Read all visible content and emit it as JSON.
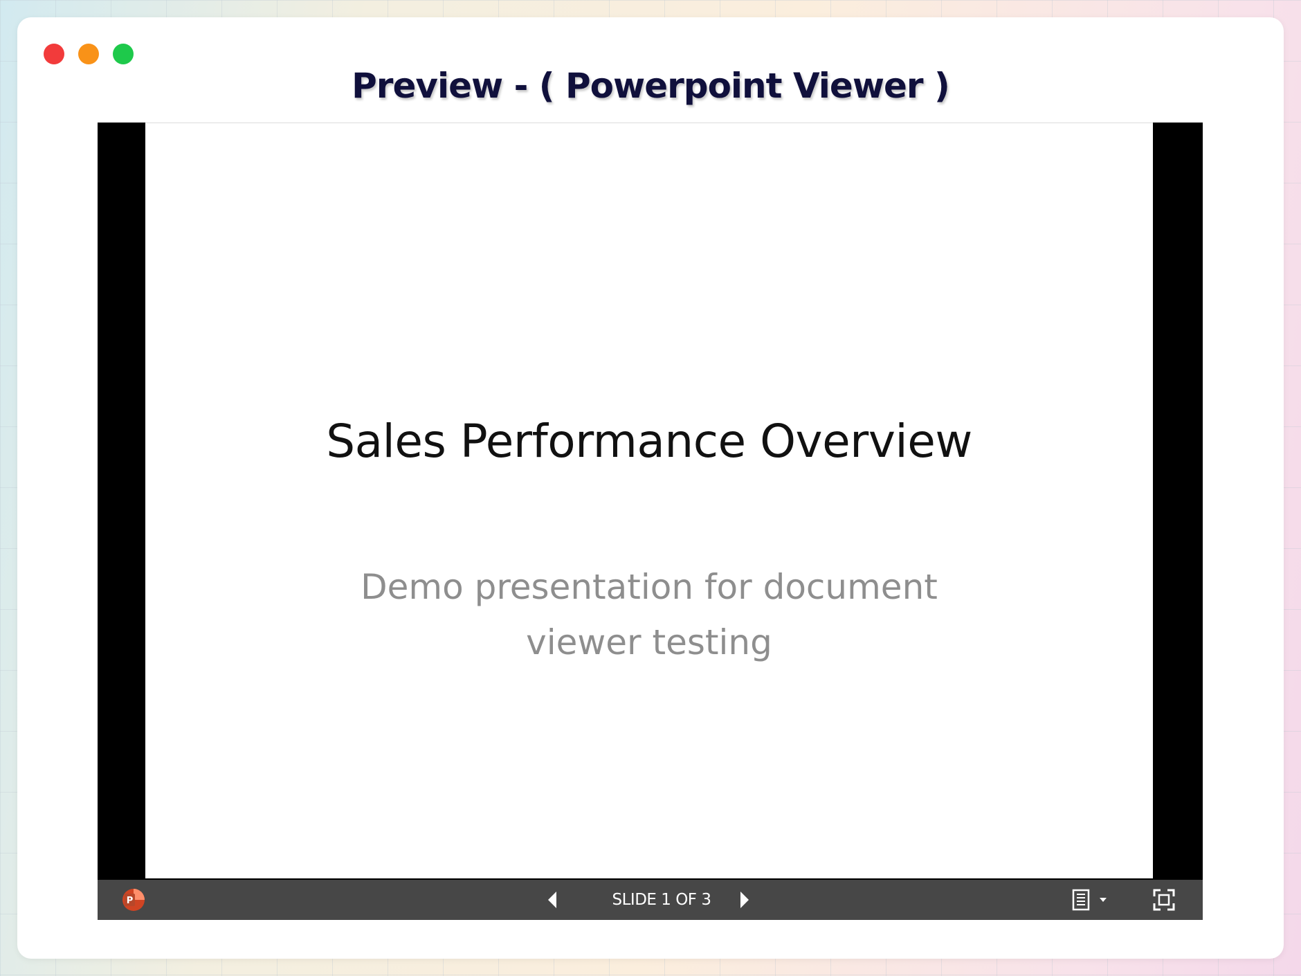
{
  "window": {
    "title": "Preview - ( Powerpoint Viewer )"
  },
  "slide": {
    "title": "Sales Performance Overview",
    "subtitle": "Demo presentation for document viewer testing"
  },
  "toolbar": {
    "slide_counter": "SLIDE 1 OF 3",
    "app_icon": "powerpoint-icon",
    "prev_icon": "chevron-left-icon",
    "next_icon": "chevron-right-icon",
    "notes_icon": "notes-icon",
    "fullscreen_icon": "fullscreen-icon"
  },
  "colors": {
    "toolbar_bg": "#474747",
    "powerpoint_brand": "#d04423",
    "title_text": "#10103c",
    "traffic_red": "#f23b3b",
    "traffic_orange": "#f99218",
    "traffic_green": "#1ec94b"
  }
}
